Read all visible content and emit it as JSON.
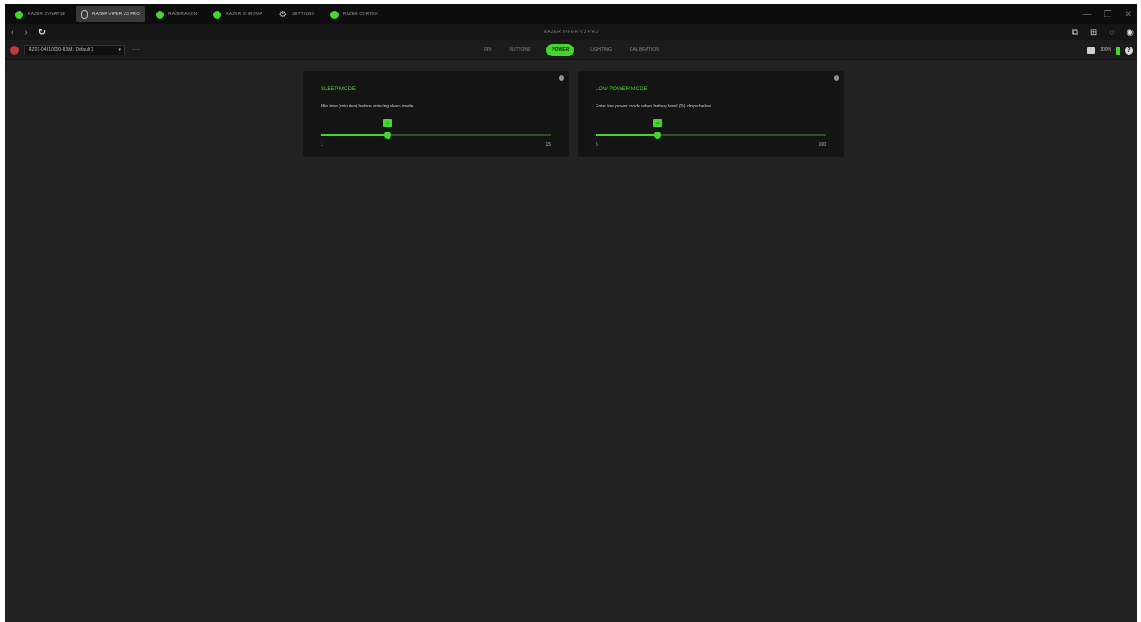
{
  "tabs": [
    {
      "label": "RAZER SYNAPSE",
      "icon": "razer-icon",
      "active": false
    },
    {
      "label": "RAZER VIPER V3 PRO",
      "icon": "mouse-icon",
      "active": true
    },
    {
      "label": "RAZER AXON",
      "icon": "axon-icon",
      "active": false
    },
    {
      "label": "RAZER CHROMA",
      "icon": "chroma-icon",
      "active": false
    },
    {
      "label": "SETTINGS",
      "icon": "gear-icon",
      "active": false
    },
    {
      "label": "RAZER CORTEX",
      "icon": "cortex-icon",
      "active": false
    }
  ],
  "window_controls": {
    "minimize": "—",
    "restore": "❐",
    "close": "✕"
  },
  "nav": {
    "back": "‹",
    "forward": "›",
    "reload": "↻",
    "title": "RAZER VIPER V3 PRO"
  },
  "profile": {
    "selected": "RZ01-04910000-R3M1 Default 1",
    "more": "···"
  },
  "subtabs": [
    "DPI",
    "BUTTONS",
    "POWER",
    "LIGHTING",
    "CALIBRATION"
  ],
  "active_subtab_index": 2,
  "status": {
    "battery_percent": "100%"
  },
  "cards": [
    {
      "title": "SLEEP MODE",
      "description": "Idle time (minutes) before entering sleep mode",
      "value": "3",
      "min": "1",
      "max": "15",
      "fraction": 0.29
    },
    {
      "title": "LOW POWER MODE",
      "description": "Enter low power mode when battery level (%) drops below",
      "value": "15",
      "min": "5",
      "max": "100",
      "fraction": 0.27
    }
  ],
  "colors": {
    "accent": "#44d62c",
    "background": "#222222",
    "card": "#141414"
  }
}
